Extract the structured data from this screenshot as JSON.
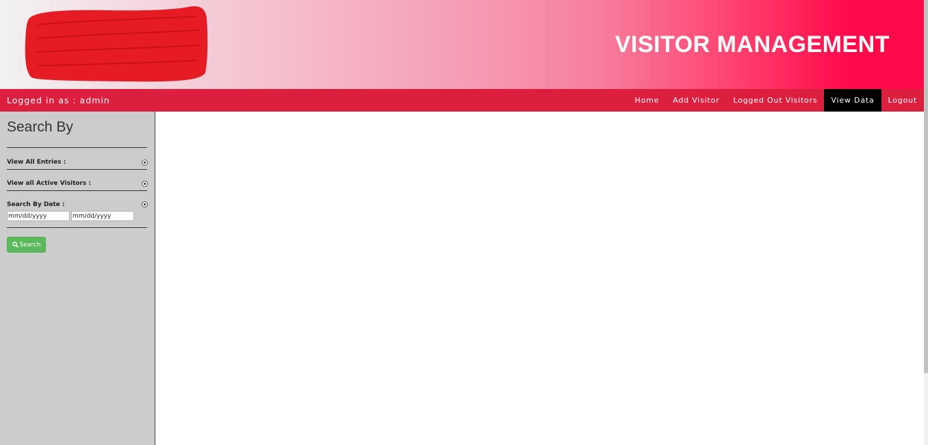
{
  "header": {
    "title": "VISITOR MANAGEMENT",
    "logo_icon": "redacted-logo-icon"
  },
  "navbar": {
    "logged_in_text": "Logged in as : admin",
    "links": [
      {
        "label": "Home"
      },
      {
        "label": "Add Visitor"
      },
      {
        "label": "Logged Out Visitors"
      },
      {
        "label": "View Data",
        "active": true
      },
      {
        "label": "Logout"
      }
    ]
  },
  "sidebar": {
    "title": "Search By",
    "options": {
      "all_entries": "View All Entries :",
      "active_visitors": "View all Active Visitors :",
      "by_date": "Search By Date :"
    },
    "date_from": {
      "placeholder": "mm/dd/yyyy"
    },
    "date_to": {
      "placeholder": "mm/dd/yyyy"
    },
    "search_button": "Search",
    "search_icon": "search-icon"
  },
  "colors": {
    "navbar": "#dc1f3f",
    "active_tab": "#000000",
    "sidebar_bg": "#cccccc",
    "button_green": "#5cb85c"
  }
}
